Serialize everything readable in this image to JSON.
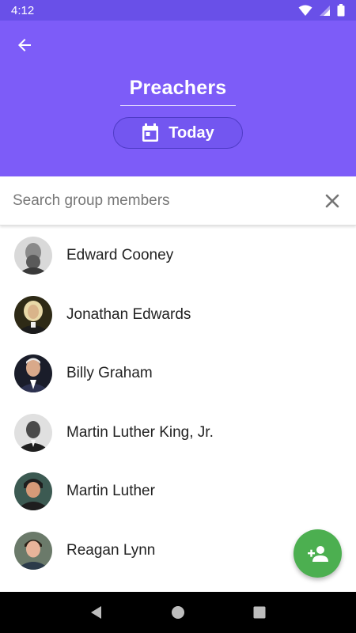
{
  "status_bar": {
    "time": "4:12",
    "icons": [
      "wifi-icon",
      "signal-icon",
      "battery-icon"
    ]
  },
  "header": {
    "title": "Preachers",
    "date_label": "Today",
    "icons": {
      "back": "arrow-left-icon",
      "calendar": "calendar-icon"
    },
    "colors": {
      "background": "#7d5cf8",
      "status_bar": "#6950e8"
    }
  },
  "search": {
    "placeholder": "Search group members",
    "value": "",
    "clear_icon": "close-icon"
  },
  "members": [
    {
      "name": "Edward Cooney"
    },
    {
      "name": "Jonathan Edwards"
    },
    {
      "name": "Billy Graham"
    },
    {
      "name": "Martin Luther King, Jr."
    },
    {
      "name": "Martin Luther"
    },
    {
      "name": "Reagan Lynn"
    }
  ],
  "fab": {
    "icon": "add-person-icon",
    "color": "#4caf50"
  },
  "nav_bar": {
    "icons": [
      "back-triangle-icon",
      "home-circle-icon",
      "recents-square-icon"
    ]
  }
}
